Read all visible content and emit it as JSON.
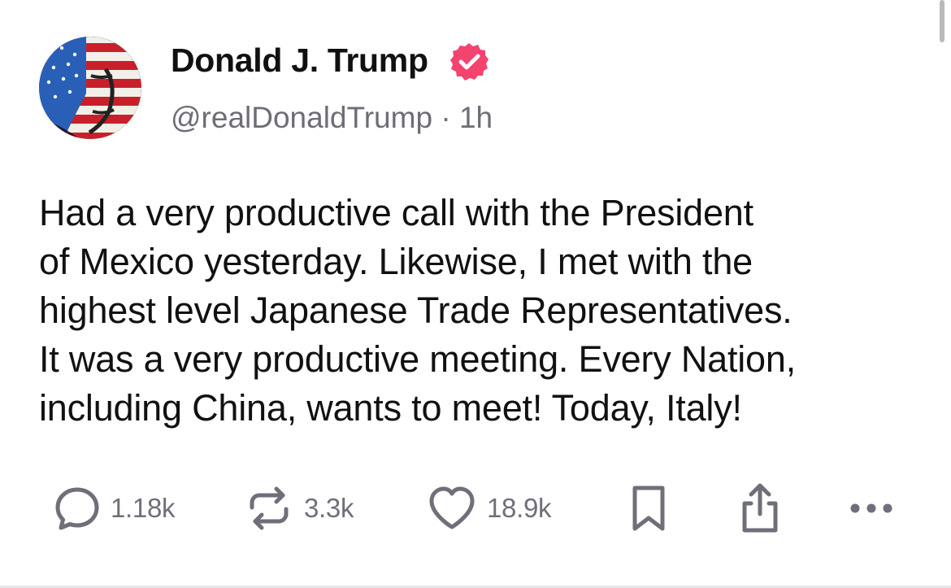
{
  "post": {
    "author": {
      "display_name": "Donald J. Trump",
      "handle": "@realDonaldTrump",
      "separator": "·",
      "timestamp": "1h",
      "verified_badge_color": "#f3436e"
    },
    "text": "Had a very productive call with the President\nof Mexico yesterday. Likewise, I met with the\nhighest level Japanese Trade Representatives.\nIt was a very productive meeting. Every Nation,\nincluding China, wants to meet! Today, Italy!",
    "actions": {
      "replies": {
        "icon": "speech-bubble-icon",
        "count": "1.18k"
      },
      "reposts": {
        "icon": "repost-arrows-icon",
        "count": "3.3k"
      },
      "likes": {
        "icon": "heart-icon",
        "count": "18.9k"
      },
      "bookmark": {
        "icon": "bookmark-icon"
      },
      "share": {
        "icon": "share-upload-icon"
      },
      "more": {
        "icon": "ellipsis-icon"
      }
    }
  },
  "colors": {
    "text_primary": "#111111",
    "text_secondary": "#6d6d78",
    "icon_gray": "#6f6f7a",
    "background": "#ffffff"
  }
}
